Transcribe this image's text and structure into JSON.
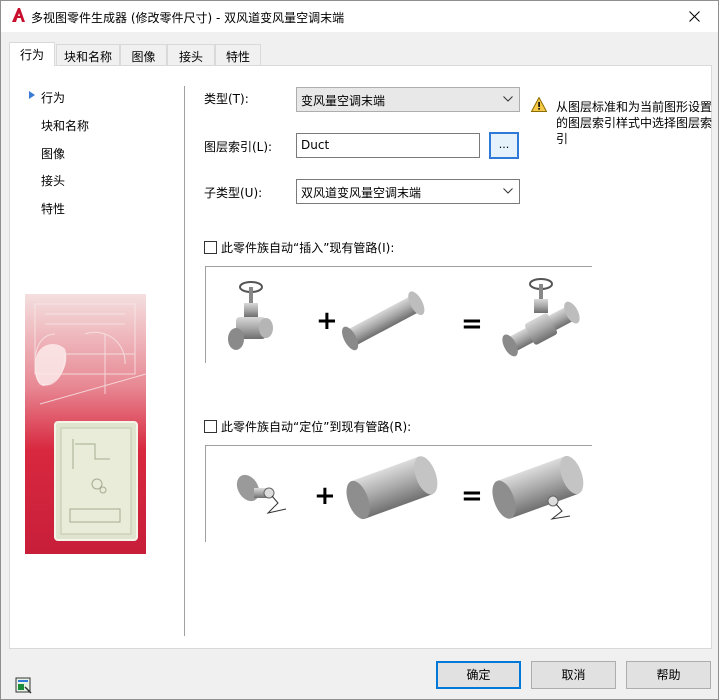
{
  "window": {
    "title": "多视图零件生成器 (修改零件尺寸) - 双风道变风量空调末端"
  },
  "tabs": [
    {
      "label": "行为",
      "active": true
    },
    {
      "label": "块和名称",
      "active": false
    },
    {
      "label": "图像",
      "active": false
    },
    {
      "label": "接头",
      "active": false
    },
    {
      "label": "特性",
      "active": false
    }
  ],
  "nav": {
    "items": [
      "行为",
      "块和名称",
      "图像",
      "接头",
      "特性"
    ],
    "selected": "行为"
  },
  "form": {
    "type_label": "类型(T):",
    "type_value": "变风量空调末端",
    "layer_key_label": "图层索引(L):",
    "layer_key_value": "Duct",
    "browse_label": "...",
    "subtype_label": "子类型(U):",
    "subtype_value": "双风道变风量空调末端",
    "warning_text": "从图层标准和为当前图形设置的图层索引样式中选择图层索引",
    "insert_checkbox_label": "此零件族自动“插入”现有管路(I):",
    "insert_checked": false,
    "locate_checkbox_label": "此零件族自动“定位”到现有管路(R):",
    "locate_checked": false
  },
  "diagrams": {
    "plus": "+",
    "equals": "="
  },
  "buttons": {
    "ok": "确定",
    "cancel": "取消",
    "help": "帮助"
  },
  "colors": {
    "accent": "#0078d7",
    "illustration_red": "#d4283c"
  }
}
